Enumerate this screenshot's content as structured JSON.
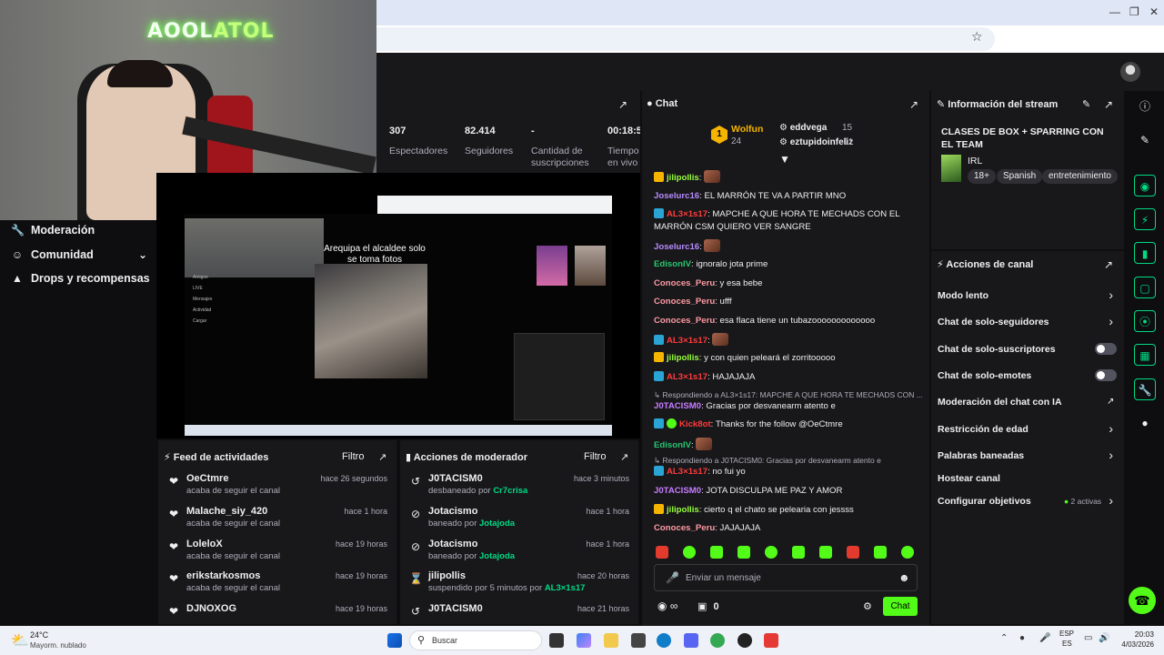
{
  "webcam": {
    "neon_text_a": "AOOL",
    "neon_text_b": "ATOL"
  },
  "sidebar": {
    "items": [
      {
        "label": "Moderación",
        "icon": "wrench-icon"
      },
      {
        "label": "Comunidad",
        "icon": "community-icon"
      },
      {
        "label": "Drops y recompensas",
        "icon": "gift-icon"
      }
    ]
  },
  "stats": {
    "items": [
      {
        "value": "307",
        "label": "Espectadores"
      },
      {
        "value": "82.414",
        "label": "Seguidores"
      },
      {
        "value": "-",
        "label": "Cantidad de suscripciones"
      },
      {
        "value": "00:18:5",
        "label": "Tiempo en vivo"
      }
    ]
  },
  "preview": {
    "caption": "Arequipa el alcaldee solo se toma fotos"
  },
  "feed": {
    "title": "Feed de actividades",
    "filter": "Filtro",
    "rows": [
      {
        "name": "OeCtmre",
        "sub": "acaba de seguir el canal",
        "time": "hace 26 segundos"
      },
      {
        "name": "Malache_siy_420",
        "sub": "acaba de seguir el canal",
        "time": "hace 1 hora"
      },
      {
        "name": "LoleloX",
        "sub": "acaba de seguir el canal",
        "time": "hace 19 horas"
      },
      {
        "name": "erikstarkosmos",
        "sub": "acaba de seguir el canal",
        "time": "hace 19 horas"
      },
      {
        "name": "DJNOXOG",
        "sub": "",
        "time": "hace 19 horas"
      }
    ]
  },
  "modactions": {
    "title": "Acciones de moderador",
    "filter": "Filtro",
    "rows": [
      {
        "name": "J0TACISM0",
        "sub": "desbaneado por",
        "by": "Cr7crisa",
        "time": "hace 3 minutos",
        "icon": "undo-icon"
      },
      {
        "name": "Jotacismo",
        "sub": "baneado por",
        "by": "Jotajoda",
        "time": "hace 1 hora",
        "icon": "ban-icon"
      },
      {
        "name": "Jotacismo",
        "sub": "baneado por",
        "by": "Jotajoda",
        "time": "hace 1 hora",
        "icon": "ban-icon"
      },
      {
        "name": "jilipollis",
        "sub": "suspendido por 5 minutos por",
        "by": "AL3×1s17",
        "time": "hace 20 horas",
        "icon": "hourglass-icon"
      },
      {
        "name": "J0TACISM0",
        "sub": "",
        "by": "",
        "time": "hace 21 horas",
        "icon": "undo-icon"
      }
    ]
  },
  "chat": {
    "title": "Chat",
    "leaderboard": {
      "rank": "1",
      "first": {
        "name": "Wolfun",
        "score": "24"
      },
      "second": {
        "name": "eddvega",
        "score": "15"
      },
      "third": {
        "name": "eztupidoinfeliz",
        "score": "11"
      }
    },
    "messages": [
      {
        "user": "jilipollis",
        "color": "#9aff3c",
        "text": "",
        "emote": true
      },
      {
        "user": "Joselurc16",
        "color": "#b98cff",
        "text": "EL MARRÓN TE VA A PARTIR MNO"
      },
      {
        "user": "AL3×1s17",
        "color": "#ff3b3b",
        "text": "MAPCHE A QUE HORA TE MECHADS CON EL MARRÓN CSM QUIERO VER SANGRE"
      },
      {
        "user": "Joselurc16",
        "color": "#b98cff",
        "text": "",
        "emote": true
      },
      {
        "user": "EdisonIV",
        "color": "#28c76f",
        "text": "ignoralo jota prime"
      },
      {
        "user": "Conoces_Peru",
        "color": "#ff9aa2",
        "text": "y esa bebe"
      },
      {
        "user": "Conoces_Peru",
        "color": "#ff9aa2",
        "text": "ufff"
      },
      {
        "user": "Conoces_Peru",
        "color": "#ff9aa2",
        "text": "esa flaca tiene un tubazooooooooooooo"
      },
      {
        "user": "AL3×1s17",
        "color": "#ff3b3b",
        "text": "",
        "emote": true
      },
      {
        "user": "jilipollis",
        "color": "#9aff3c",
        "text": "y con quien peleará el zorritooooo"
      },
      {
        "user": "AL3×1s17",
        "color": "#ff3b3b",
        "text": "HAJAJAJA"
      },
      {
        "reply": "Respondiendo a AL3×1s17: MAPCHE A QUE HORA TE MECHADS CON ..."
      },
      {
        "user": "J0TACISM0",
        "color": "#c77dff",
        "text": "Gracias por desvanearm atento e"
      },
      {
        "user": "Kick8ot",
        "color": "#ff3b3b",
        "text": "Thanks for the follow @OeCtmre"
      },
      {
        "user": "EdisonIV",
        "color": "#28c76f",
        "text": "",
        "emote": true
      },
      {
        "reply": "Respondiendo a J0TACISM0: Gracias por desvanearm atento e"
      },
      {
        "user": "AL3×1s17",
        "color": "#ff3b3b",
        "text": "no fui yo"
      },
      {
        "user": "J0TACISM0",
        "color": "#c77dff",
        "text": "JOTA DISCULPA ME PAZ Y AMOR"
      },
      {
        "user": "jilipollis",
        "color": "#9aff3c",
        "text": "cierto q el chato se pelearia con jessss"
      },
      {
        "user": "Conoces_Peru",
        "color": "#ff9aa2",
        "text": "JAJAJAJA"
      }
    ],
    "input_placeholder": "Enviar un mensaje",
    "points": "0",
    "infinity": "∞",
    "send_label": "Chat"
  },
  "info": {
    "title": "Información del stream",
    "stream_title": "CLASES DE BOX + SPARRING CON EL TEAM",
    "category": "IRL",
    "tags": [
      "18+",
      "Spanish",
      "entretenimiento"
    ]
  },
  "channel_actions": {
    "title": "Acciones de canal",
    "items": [
      {
        "label": "Modo lento",
        "control": "chevron"
      },
      {
        "label": "Chat de solo-seguidores",
        "control": "chevron"
      },
      {
        "label": "Chat de solo-suscriptores",
        "control": "toggle"
      },
      {
        "label": "Chat de solo-emotes",
        "control": "toggle"
      },
      {
        "label": "Moderación del chat con IA",
        "control": "external"
      },
      {
        "label": "Restricción de edad",
        "control": "chevron"
      },
      {
        "label": "Palabras baneadas",
        "control": "chevron"
      },
      {
        "label": "Hostear canal",
        "control": "none"
      },
      {
        "label": "Configurar objetivos",
        "control": "chevron",
        "extra": "2 activas"
      }
    ]
  },
  "taskbar": {
    "weather_temp": "24°C",
    "weather_desc": "Mayorm. nublado",
    "search": "Buscar",
    "lang1": "ESP",
    "lang2": "ES",
    "time": "20:03",
    "date": "4/03/2026"
  },
  "colors": {
    "accent": "#53fc18",
    "panel": "#18181b",
    "bg": "#0e0e10"
  }
}
